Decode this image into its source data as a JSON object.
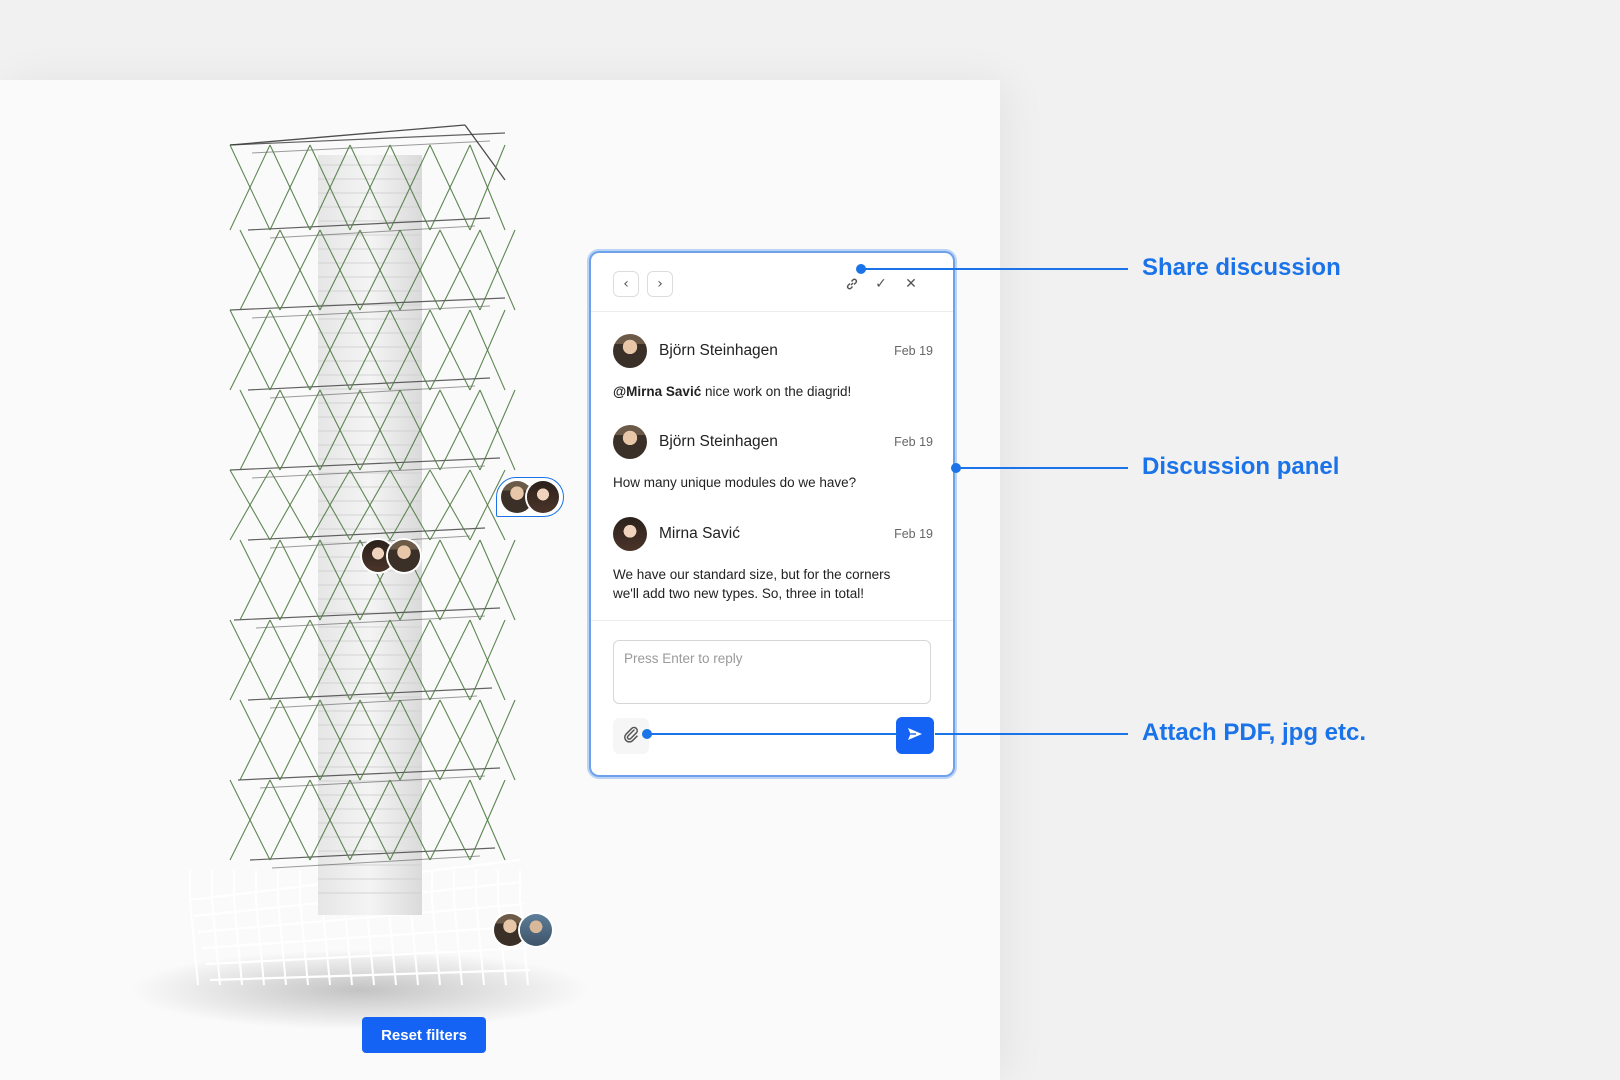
{
  "viewer": {
    "reset_filters_label": "Reset filters"
  },
  "pins": [
    {
      "name": "pin-selected",
      "avatars": [
        "Björn Steinhagen",
        "Mirna Savić"
      ],
      "selected": true
    },
    {
      "name": "pin-mid",
      "avatars": [
        "Mirna Savić",
        "Björn Steinhagen"
      ],
      "selected": false
    },
    {
      "name": "pin-base",
      "avatars": [
        "Björn Steinhagen",
        "Guest"
      ],
      "selected": false
    }
  ],
  "discussion": {
    "header_icons": [
      "chevron-left-icon",
      "chevron-right-icon",
      "link-icon",
      "check-icon",
      "close-icon"
    ],
    "messages": [
      {
        "author": "Björn Steinhagen",
        "date": "Feb 19",
        "mention": "@Mirna Savić",
        "text": " nice work on the diagrid!"
      },
      {
        "author": "Björn Steinhagen",
        "date": "Feb 19",
        "mention": "",
        "text": "How many unique modules do we have?"
      },
      {
        "author": "Mirna Savić",
        "date": "Feb 19",
        "mention": "",
        "text": "We have our standard size, but for the corners we'll add two new types. So, three in total!"
      }
    ],
    "reply_placeholder": "Press Enter to reply",
    "attach_icon": "paperclip-icon",
    "send_icon": "send-icon"
  },
  "annotations": {
    "share": "Share discussion",
    "panel": "Discussion panel",
    "attach": "Attach PDF, jpg etc."
  },
  "colors": {
    "accent": "#1a73e8",
    "button": "#1563f4",
    "structure": "#4f7a43"
  }
}
